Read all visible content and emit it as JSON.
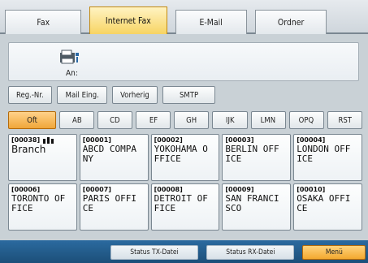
{
  "colors": {
    "active_tab": "#f7d463",
    "active_filter": "#f0a63a",
    "background": "#c9d1d6",
    "statusbar": "#1c4f79"
  },
  "tabs": [
    {
      "label": "Fax",
      "active": false
    },
    {
      "label": "Internet Fax",
      "active": true
    },
    {
      "label": "E-Mail",
      "active": false
    },
    {
      "label": "Ordner",
      "active": false
    }
  ],
  "destination": {
    "icon": "printer-icon",
    "label": "An:"
  },
  "actions": {
    "reg_nr": "Reg.-Nr.",
    "mail_eing": "Mail Eing.",
    "vorherig": "Vorherig",
    "smtp": "SMTP"
  },
  "filters": [
    {
      "label": "Oft",
      "active": true
    },
    {
      "label": "AB",
      "active": false
    },
    {
      "label": "CD",
      "active": false
    },
    {
      "label": "EF",
      "active": false
    },
    {
      "label": "GH",
      "active": false
    },
    {
      "label": "IJK",
      "active": false
    },
    {
      "label": "LMN",
      "active": false
    },
    {
      "label": "OPQ",
      "active": false
    },
    {
      "label": "RST",
      "active": false
    }
  ],
  "entries": [
    {
      "num": "[00038]",
      "badge_icon": "group-badge-icon",
      "name": "Branch"
    },
    {
      "num": "[00001]",
      "name": "ABCD COMPA\nNY"
    },
    {
      "num": "[00002]",
      "name": "YOKOHAMA O\nFFICE"
    },
    {
      "num": "[00003]",
      "name": "BERLIN OFF\nICE"
    },
    {
      "num": "[00004]",
      "name": "LONDON OFF\nICE"
    },
    {
      "num": "[00006]",
      "name": "TORONTO OF\nFICE"
    },
    {
      "num": "[00007]",
      "name": "PARIS OFFI\nCE"
    },
    {
      "num": "[00008]",
      "name": "DETROIT OF\nFICE"
    },
    {
      "num": "[00009]",
      "name": "SAN FRANCI\nSCO"
    },
    {
      "num": "[00010]",
      "name": "OSAKA OFFI\nCE"
    }
  ],
  "statusbar": {
    "button_1": "Status TX-Datei",
    "button_2": "Status RX-Datei",
    "button_3": "Menü"
  }
}
